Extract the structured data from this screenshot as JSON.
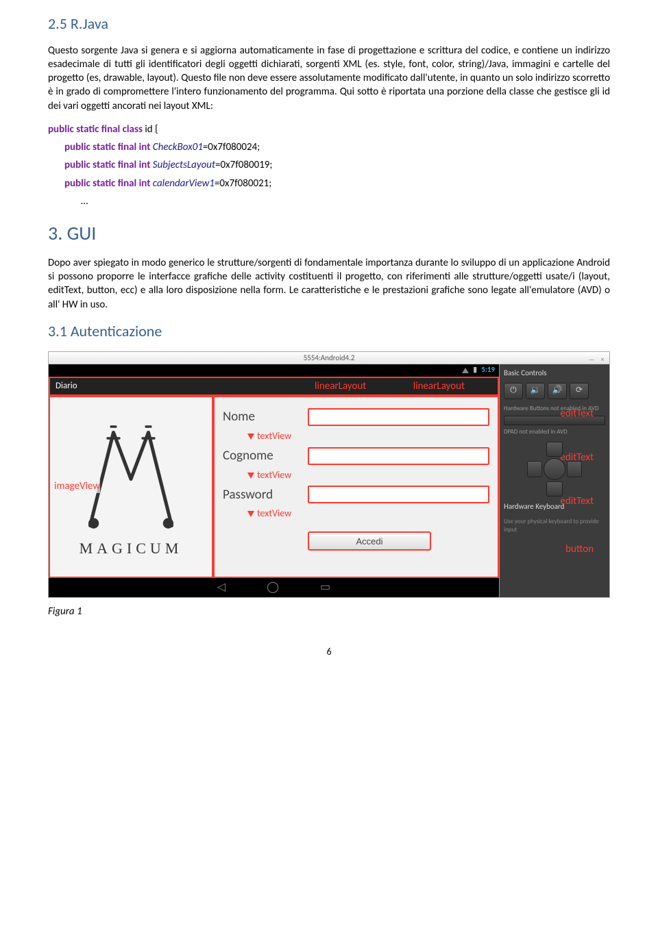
{
  "section1": {
    "title": "2.5 R.Java",
    "paragraph": "Questo sorgente Java si genera e si aggiorna automaticamente in fase di progettazione e scrittura del codice, e contiene un indirizzo esadecimale di tutti gli identificatori degli oggetti dichiarati, sorgenti XML (es. style, font, color, string)/Java, immagini e cartelle del progetto (es, drawable, layout). Questo file non deve essere assolutamente modificato dall'utente, in quanto un solo indirizzo scorretto è in grado di compromettere l'intero funzionamento del programma. Qui sotto è riportata una porzione della classe che gestisce gli id dei vari oggetti ancorati nei layout XML:"
  },
  "code": {
    "l1_kw": "public static final class ",
    "l1_rest": "id {",
    "l2_kw": "public static final int ",
    "l2_var": "CheckBox01",
    "l2_rest": "=0x7f080024;",
    "l3_kw": "public static final int ",
    "l3_var": "SubjectsLayout",
    "l3_rest": "=0x7f080019;",
    "l4_kw": "public static final int ",
    "l4_var": "calendarView1",
    "l4_rest": "=0x7f080021;",
    "ellipsis": "…"
  },
  "section2": {
    "title": "3. GUI",
    "paragraph": "Dopo aver spiegato in modo generico le strutture/sorgenti di fondamentale importanza durante lo sviluppo di un applicazione Android si possono proporre le interfacce grafiche delle activity costituenti il progetto, con riferimenti alle strutture/oggetti usate/i (layout, editText, button, ecc) e alla loro disposizione nella form. Le caratteristiche e le prestazioni grafiche sono legate all'emulatore (AVD) o all' HW in uso."
  },
  "section3": {
    "title": "3.1 Autenticazione"
  },
  "emulator": {
    "window_title": "5554:Android4.2",
    "clock": "5:19",
    "app_title": "Diario",
    "linear_layout_label": "linearLayout",
    "image_view_label": "imageView",
    "magicum": "MAGICUM",
    "fields": {
      "nome": "Nome",
      "cognome": "Cognome",
      "password": "Password"
    },
    "textview_label": "textView",
    "edittext_label": "editText",
    "button_annotation": "button",
    "accedi": "Accedi",
    "sidepanel": {
      "basic_controls": "Basic Controls",
      "hw_buttons": "Hardware Buttons not enabled in AVD",
      "dpad": "DPAD not enabled in AVD",
      "hw_kbd_title": "Hardware Keyboard",
      "hw_kbd_sub": "Use your physical keyboard to provide input"
    }
  },
  "figure_caption": "Figura 1",
  "page_number": "6"
}
